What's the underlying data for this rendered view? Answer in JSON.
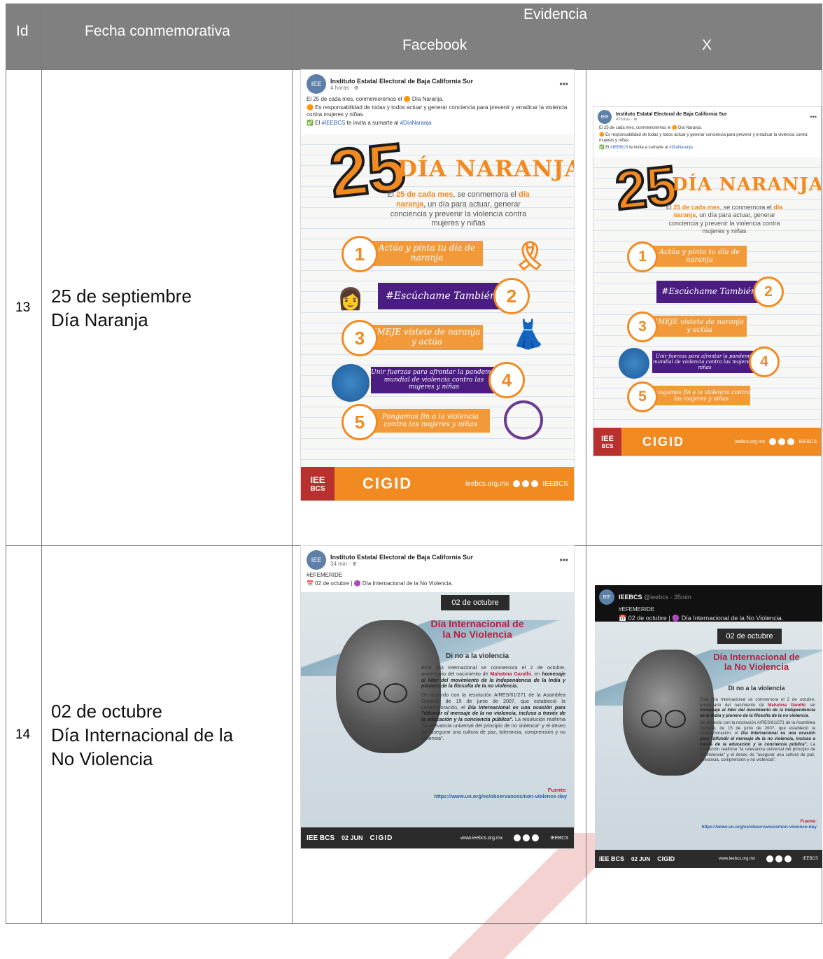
{
  "table": {
    "headers": {
      "id": "Id",
      "fecha": "Fecha conmemorativa",
      "evidencia": "Evidencia",
      "facebook": "Facebook",
      "x": "X"
    },
    "rows": [
      {
        "id": "13",
        "fecha_line1": "25 de septiembre",
        "fecha_line2": "Día Naranja"
      },
      {
        "id": "14",
        "fecha_line1": "02 de octubre",
        "fecha_line2": "Día Internacional de la",
        "fecha_line3": "No Violencia"
      }
    ]
  },
  "post_naranja": {
    "author": "Instituto Estatal Electoral de Baja California Sur",
    "time": "4 horas · ⊕",
    "line1": "El 25 de cada mes, conmemoremos el 🟠 Día Naranja.",
    "line2": "🟠 Es responsabilidad de todas y todos actuar y generar conciencia para prevenir y erradicar la violencia contra mujeres y niñas.",
    "line3_pre": "✅ El ",
    "tag1": "#IEEBCS",
    "line3_mid": " te invita a sumarte al ",
    "tag2": "#DíaNaranja",
    "poster": {
      "big": "25",
      "title": "DÍA NARANJA",
      "intro_a": "El ",
      "intro_b": "25 de cada mes",
      "intro_c": ", se conmemora el",
      "intro_d": "día naranja",
      "intro_e": ", un día para actuar, generar conciencia y prevenir la violencia contra mujeres y niñas",
      "items": [
        "Actúa y pinta tu día de naranja",
        "#Escúchame También",
        "IMEJE vístete de naranja y actúa",
        "Unir fuerzas para afrontar la pandemia mundial de violencia contra las mujeres y niñas",
        "Pongamos fin a la violencia contra las mujeres y niñas"
      ],
      "numbers": [
        "1",
        "2",
        "3",
        "4",
        "5"
      ],
      "footer_iee": "IEE",
      "footer_bcs": "BCS",
      "footer_cigid": "CIGID",
      "footer_web": "ieebcs.org.mx",
      "footer_handle": "IEEBCS"
    }
  },
  "post_gandhi_fb": {
    "author": "Instituto Estatal Electoral de Baja California Sur",
    "time": "34 min · ⊕",
    "tag": "#EFEMERIDE",
    "line": "📅 02 de octubre | 🟣 Día Internacional de la No Violencia."
  },
  "post_gandhi_x": {
    "author": "IEEBCS",
    "handle": "@ieebcs · 35min",
    "tag": "#EFEMERIDE",
    "line": "📅 02 de octubre | 🟣 Día Internacional de la No Violencia."
  },
  "gandhi_poster": {
    "date": "02 de octubre",
    "title1": "Día Internacional de",
    "title2": "la No Violencia",
    "subtitle": "Di no a la violencia",
    "p1_a": "Este Día Internacional se conmemora el 2 de octubre, aniversario del nacimiento de ",
    "p1_b": "Mahatma Gandhi",
    "p1_c": ", en ",
    "p1_d": "homenaje al líder del movimiento de la Independencia de la India y pionero de la filosofía de la no violencia.",
    "p2_a": "De acuerdo con la resolución A/RES/61/271 de la Asamblea General, de 15 de junio de 2007, que estableció la conmemoración, el ",
    "p2_b": "Día Internacional es una ocasión para \"difundir el mensaje de la no violencia, incluso a través de la educación y la conciencia pública\".",
    "p2_c": " La resolución reafirma \"la relevancia universal del principio de no violencia\" y el deseo de \"asegurar una cultura de paz, tolerancia, comprensión y no violencia\".",
    "source_label": "Fuente:",
    "source_url": "https://www.un.org/es/observances/non-violence-day",
    "footer_web": "www.ieebcs.org.mx",
    "footer_handle": "IEEBCS",
    "footer_cigid": "CIGID",
    "footer_date": "02 JUN"
  }
}
